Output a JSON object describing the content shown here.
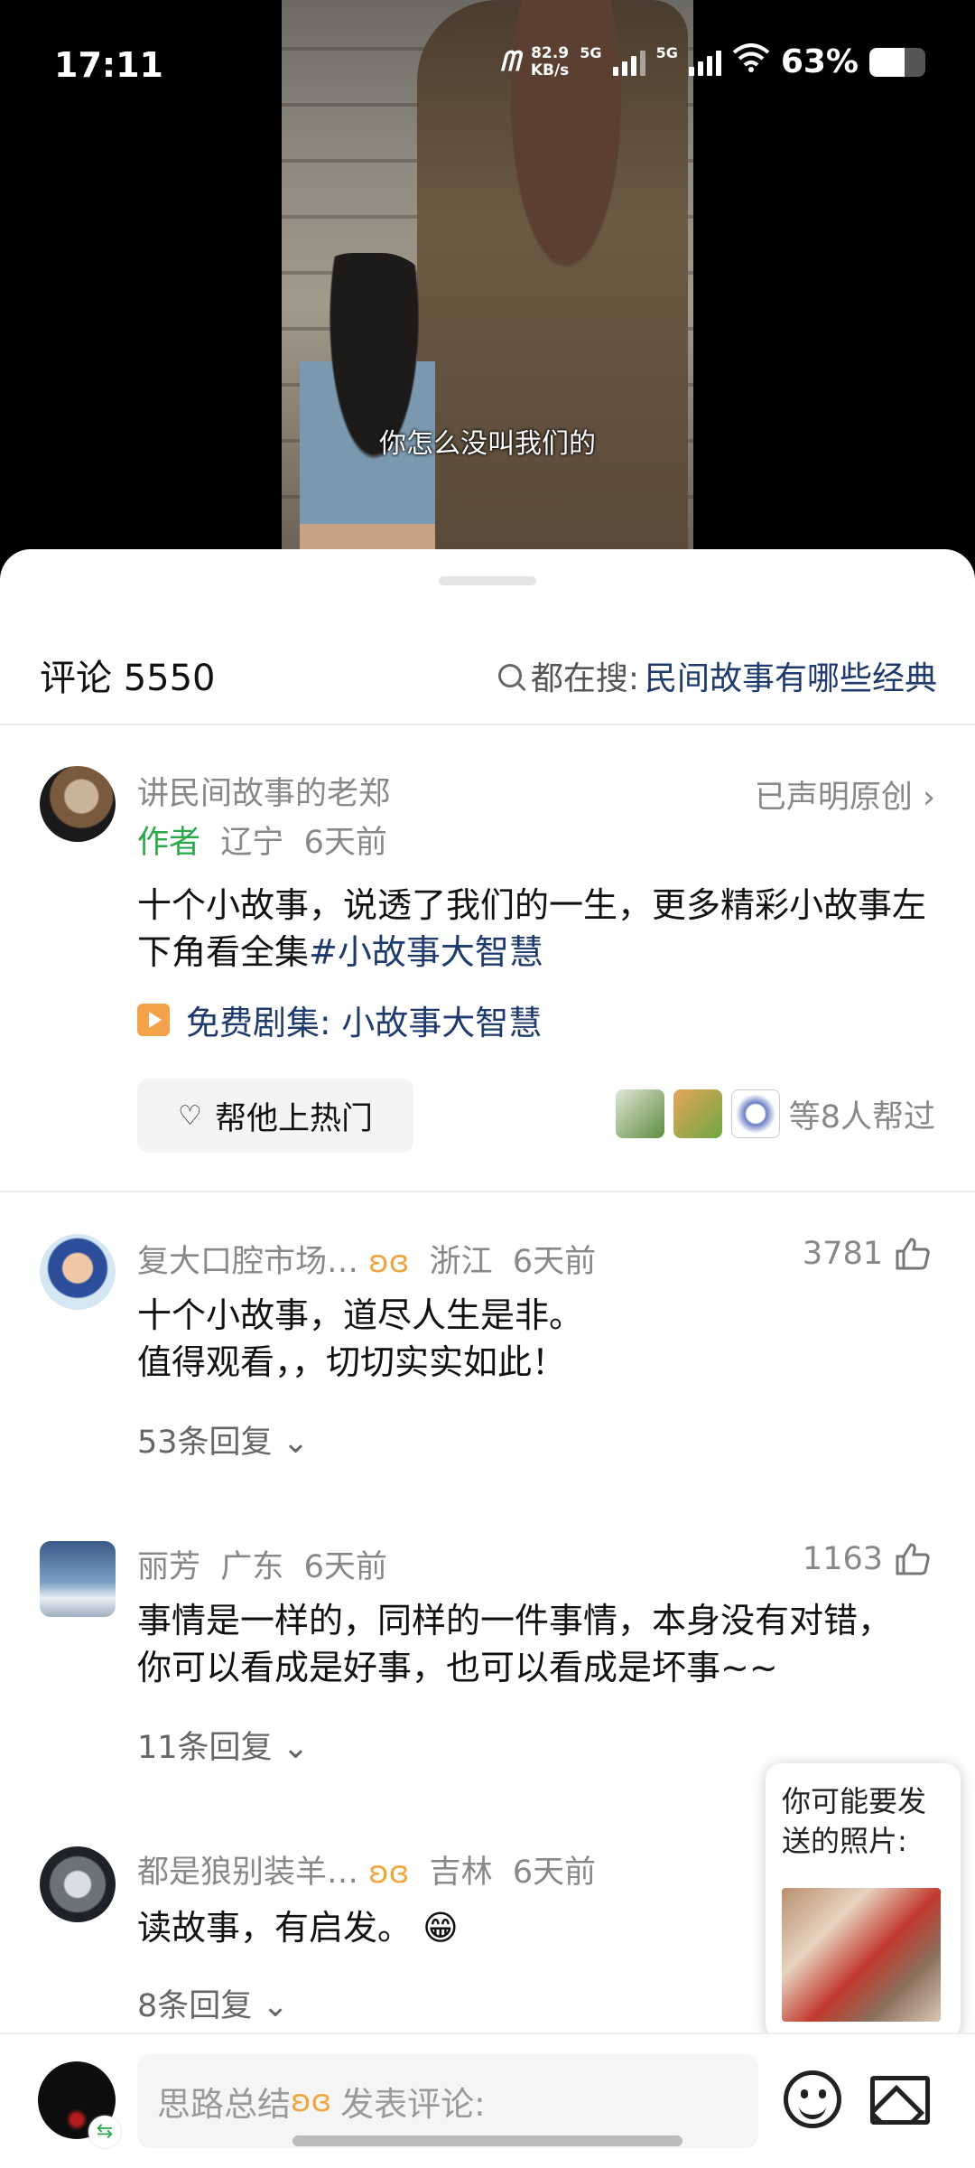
{
  "status_bar": {
    "time": "17:11",
    "net_speed_value": "82.9",
    "net_speed_unit": "KB/s",
    "sim1_label": "5G",
    "sim2_label": "5G",
    "battery": "63%",
    "battery_level": 0.63
  },
  "video": {
    "subtitle": "你怎么没叫我们的"
  },
  "header": {
    "comment_count": "评论 5550",
    "search_prefix": "都在搜:",
    "search_query": "民间故事有哪些经典"
  },
  "pinned_comment": {
    "author": "讲民间故事的老郑",
    "declare": "已声明原创",
    "author_tag": "作者",
    "location": "辽宁",
    "time": "6天前",
    "text": "十个小故事，说透了我们的一生，更多精彩小故事左下角看全集",
    "hashtag": "#小故事大智慧",
    "series_label": "免费剧集: 小故事大智慧",
    "hot_button": "帮他上热门",
    "helpers_text": "等8人帮过"
  },
  "comments": [
    {
      "name": "复大口腔市场…",
      "location": "浙江",
      "time": "6天前",
      "likes": "3781",
      "line1": "十个小故事，道尽人生是非。",
      "line2": "值得观看，，切切实实如此！",
      "replies": "53条回复"
    },
    {
      "name": "丽芳",
      "location": "广东",
      "time": "6天前",
      "likes": "1163",
      "line1": "事情是一样的，同样的一件事情，本身没有对错，",
      "line2": "你可以看成是好事，也可以看成是坏事~~",
      "replies": "11条回复"
    },
    {
      "name": "都是狼别装羊…",
      "location": "吉林",
      "time": "6天前",
      "line1": "读故事，有启发。",
      "emoji": "😁",
      "replies": "8条回复"
    }
  ],
  "photo_popup": {
    "text": "你可能要发送的照片:"
  },
  "input_bar": {
    "placeholder_prefix": "思路总结",
    "placeholder": "发表评论:"
  },
  "icons": {
    "vip": "butterfly-icon",
    "like": "thumb-up-icon",
    "emoji": "smile-icon",
    "image": "image-icon"
  }
}
